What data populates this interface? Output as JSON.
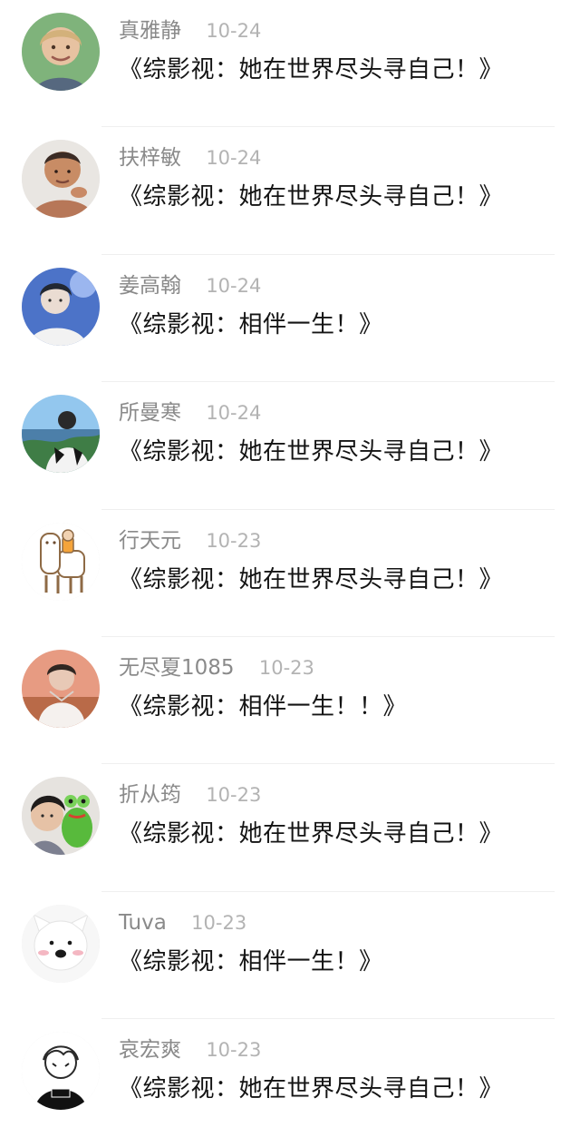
{
  "comments": [
    {
      "name": "真雅静",
      "date": "10-24",
      "text": "《综影视：她在世界尽头寻自己！》",
      "avatar": "avatar-child-icon"
    },
    {
      "name": "扶梓敏",
      "date": "10-24",
      "text": "《综影视：她在世界尽头寻自己！》",
      "avatar": "avatar-man-icon"
    },
    {
      "name": "姜高翰",
      "date": "10-24",
      "text": "《综影视：相伴一生！》",
      "avatar": "avatar-blue-portrait-icon"
    },
    {
      "name": "所曼寒",
      "date": "10-24",
      "text": "《综影视：她在世界尽头寻自己！》",
      "avatar": "avatar-landscape-person-icon"
    },
    {
      "name": "行天元",
      "date": "10-23",
      "text": "《综影视：她在世界尽头寻自己！》",
      "avatar": "avatar-alpaca-icon"
    },
    {
      "name": "无尽夏1085",
      "date": "10-23",
      "text": "《综影视：相伴一生！！》",
      "avatar": "avatar-desert-person-icon"
    },
    {
      "name": "折从筠",
      "date": "10-23",
      "text": "《综影视：她在世界尽头寻自己！》",
      "avatar": "avatar-person-frog-icon"
    },
    {
      "name": "Tuva",
      "date": "10-23",
      "text": "《综影视：相伴一生！》",
      "avatar": "avatar-white-dog-icon"
    },
    {
      "name": "哀宏爽",
      "date": "10-23",
      "text": "《综影视：她在世界尽头寻自己！》",
      "avatar": "avatar-anime-girl-icon"
    }
  ]
}
